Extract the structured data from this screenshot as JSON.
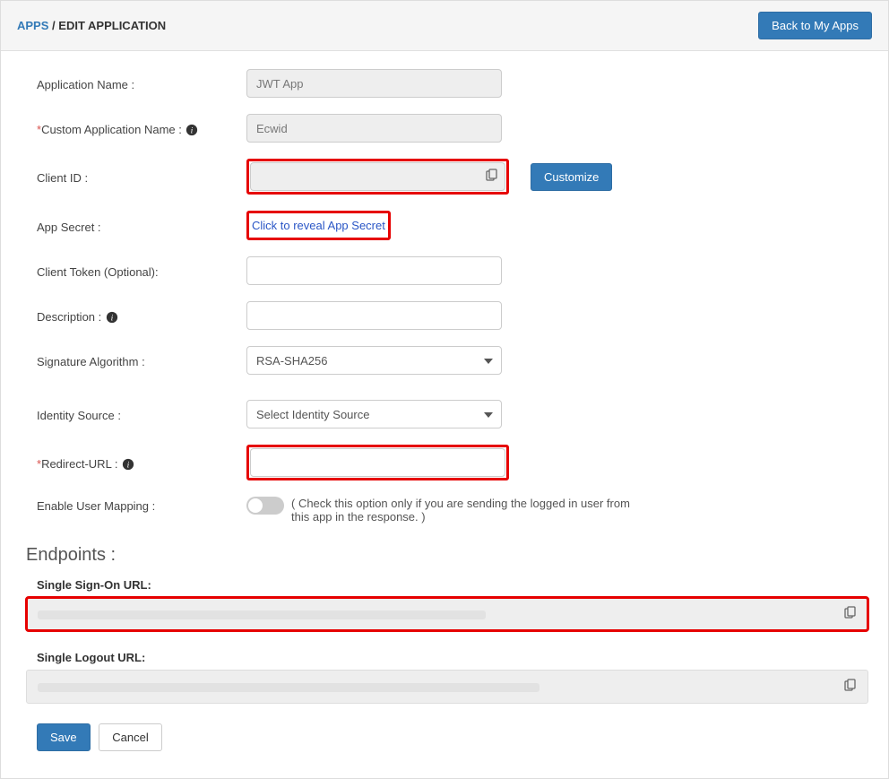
{
  "header": {
    "breadcrumb_first": "APPS",
    "breadcrumb_sep": "/",
    "breadcrumb_second": "EDIT APPLICATION",
    "back_btn": "Back to My Apps"
  },
  "form": {
    "app_name_label": "Application Name :",
    "app_name_value": "JWT App",
    "custom_name_label": "Custom Application Name :",
    "custom_name_value": "Ecwid",
    "client_id_label": "Client ID :",
    "client_id_value": "",
    "customize_btn": "Customize",
    "app_secret_label": "App Secret :",
    "app_secret_link": "Click to reveal App Secret",
    "client_token_label": "Client Token (Optional):",
    "client_token_value": "",
    "description_label": "Description :",
    "description_value": "",
    "sig_alg_label": "Signature Algorithm :",
    "sig_alg_value": "RSA-SHA256",
    "identity_source_label": "Identity Source :",
    "identity_source_value": "Select Identity Source",
    "redirect_url_label": "Redirect-URL :",
    "redirect_url_value": "",
    "enable_mapping_label": "Enable User Mapping :",
    "enable_mapping_hint": "( Check this option only if you are sending the logged in user from this app in the response. )"
  },
  "endpoints": {
    "heading": "Endpoints :",
    "sso_label": "Single Sign-On URL:",
    "sso_value": "",
    "slo_label": "Single Logout URL:",
    "slo_value": ""
  },
  "footer": {
    "save": "Save",
    "cancel": "Cancel"
  }
}
